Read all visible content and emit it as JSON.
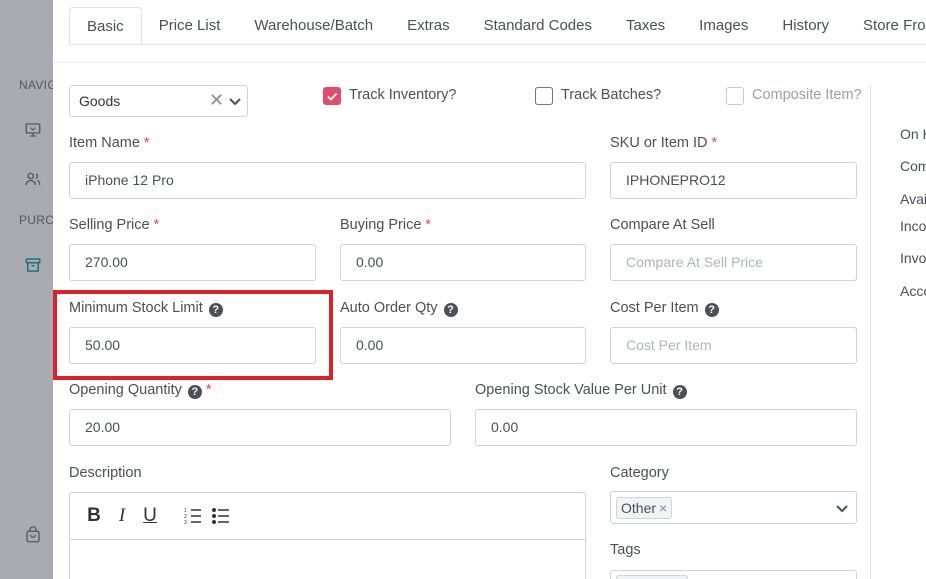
{
  "sidebar": {
    "section_nav": "NAVIG",
    "section_purchases": "PURC",
    "icons": [
      "monitor-icon",
      "users-icon",
      "archive-icon",
      "shopping-bag-icon"
    ]
  },
  "tabs": [
    {
      "label": "Basic",
      "active": true
    },
    {
      "label": "Price List"
    },
    {
      "label": "Warehouse/Batch"
    },
    {
      "label": "Extras"
    },
    {
      "label": "Standard Codes"
    },
    {
      "label": "Taxes"
    },
    {
      "label": "Images"
    },
    {
      "label": "History"
    },
    {
      "label": "Store Front"
    }
  ],
  "item_type": {
    "value": "Goods",
    "clear_glyph": "✕"
  },
  "checkboxes": {
    "track_inventory": {
      "label": "Track Inventory?",
      "checked": true
    },
    "track_batches": {
      "label": "Track Batches?",
      "checked": false
    },
    "composite_item": {
      "label": "Composite Item?",
      "checked": false,
      "disabled": true
    }
  },
  "required_mark": "*",
  "help_glyph": "?",
  "fields": {
    "item_name": {
      "label": "Item Name",
      "value": "iPhone 12 Pro"
    },
    "sku": {
      "label": "SKU or Item ID",
      "value": "IPHONEPRO12"
    },
    "selling_price": {
      "label": "Selling Price",
      "value": "270.00"
    },
    "buying_price": {
      "label": "Buying Price",
      "value": "0.00"
    },
    "compare_at_sell": {
      "label": "Compare At Sell",
      "placeholder": "Compare At Sell Price"
    },
    "min_stock_limit": {
      "label": "Minimum Stock Limit",
      "value": "50.00"
    },
    "auto_order_qty": {
      "label": "Auto Order Qty",
      "value": "0.00"
    },
    "cost_per_item": {
      "label": "Cost Per Item",
      "placeholder": "Cost Per Item"
    },
    "opening_quantity": {
      "label": "Opening Quantity",
      "value": "20.00"
    },
    "opening_stock_value": {
      "label": "Opening Stock Value Per Unit",
      "value": "0.00"
    }
  },
  "description": {
    "label": "Description",
    "toolbar": {
      "bold": "B",
      "italic": "I",
      "underline": "U"
    }
  },
  "category": {
    "label": "Category",
    "chip": "Other",
    "chip_remove": "×"
  },
  "tags": {
    "label": "Tags"
  },
  "right_panel": [
    "On H",
    "Com",
    "Avai",
    "Inco",
    "Invo",
    "Acco"
  ],
  "colors": {
    "accent": "#e24c6a",
    "highlight": "#d8232a",
    "required": "#e24c4b",
    "sidebar": "#a9abb2"
  }
}
